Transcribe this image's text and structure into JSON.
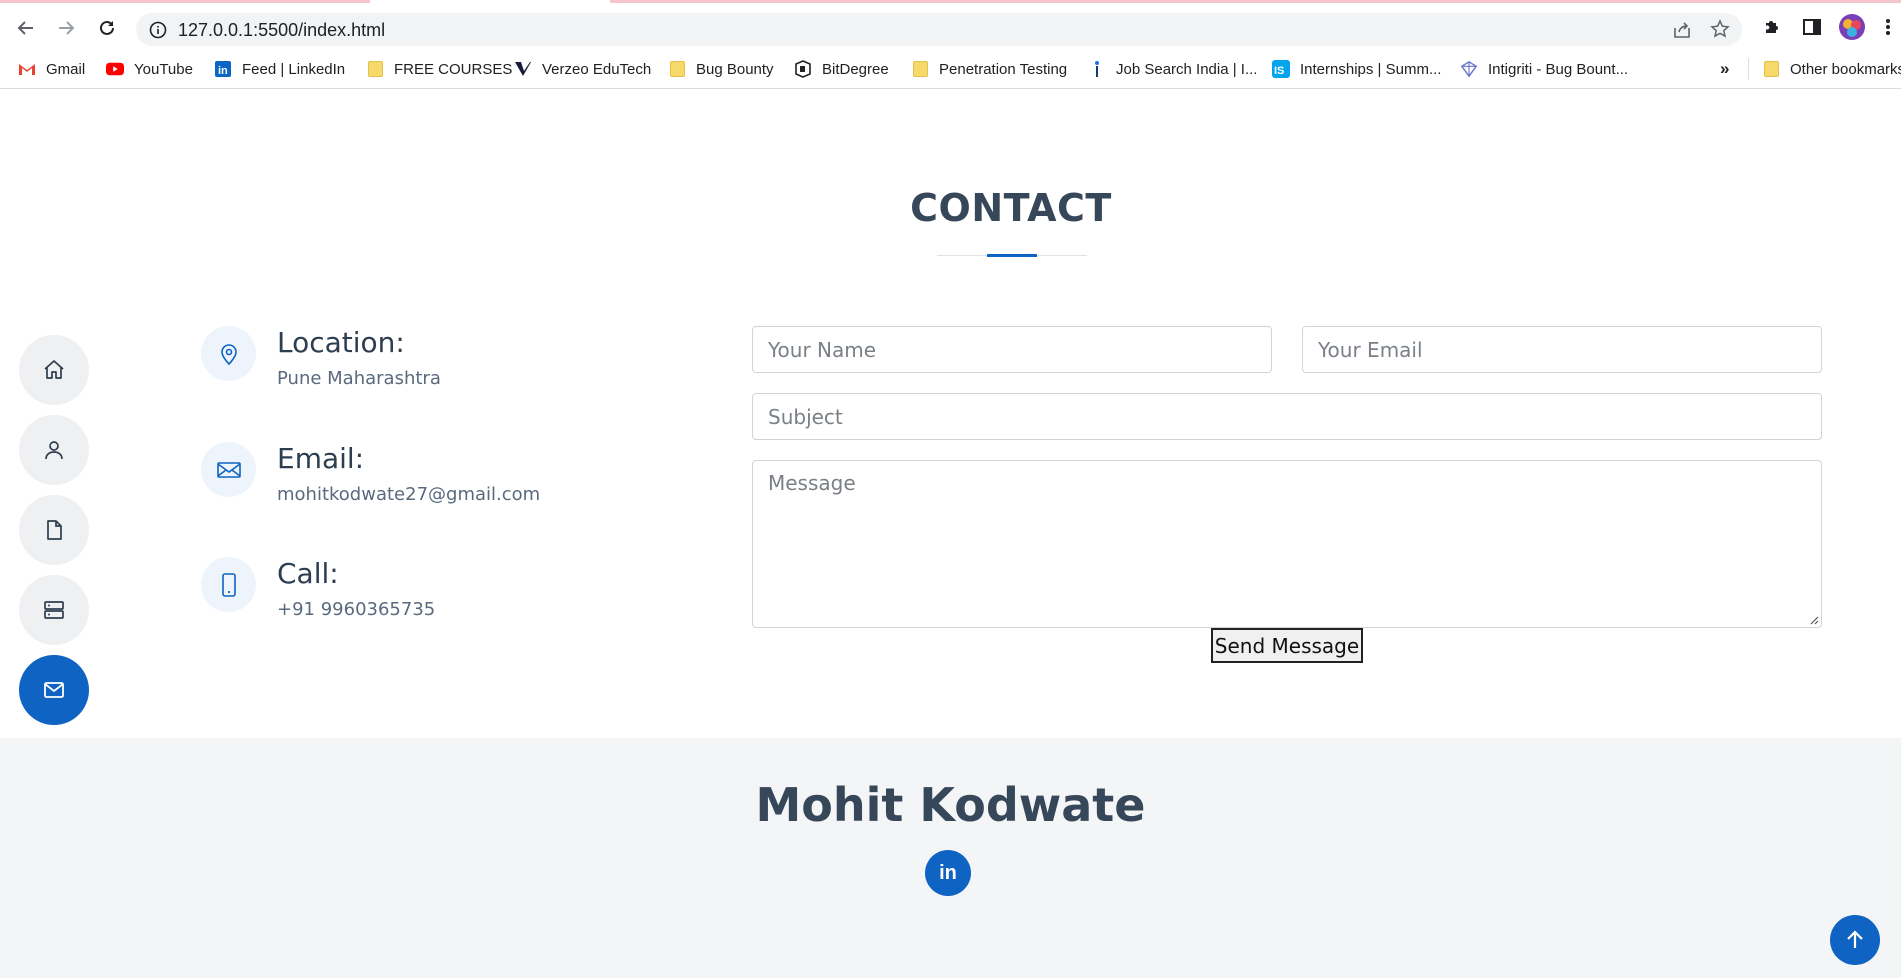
{
  "browser": {
    "url": "127.0.0.1:5500/index.html",
    "bookmarks": [
      {
        "label": "Gmail"
      },
      {
        "label": "YouTube"
      },
      {
        "label": "Feed | LinkedIn"
      },
      {
        "label": "FREE COURSES"
      },
      {
        "label": "Verzeo EduTech"
      },
      {
        "label": "Bug Bounty"
      },
      {
        "label": "BitDegree"
      },
      {
        "label": "Penetration Testing"
      },
      {
        "label": "Job Search India | I..."
      },
      {
        "label": "Internships | Summ..."
      },
      {
        "label": "Intigriti - Bug Bount..."
      }
    ],
    "overflow_label": "»",
    "other_bookmarks": "Other bookmarks"
  },
  "section": {
    "title": "CONTACT"
  },
  "contact_info": [
    {
      "label": "Location:",
      "value": "Pune Maharashtra",
      "icon": "map-pin-icon"
    },
    {
      "label": "Email:",
      "value": "mohitkodwate27@gmail.com",
      "icon": "envelope-icon"
    },
    {
      "label": "Call:",
      "value": "+91 9960365735",
      "icon": "phone-icon"
    }
  ],
  "form": {
    "name_placeholder": "Your Name",
    "email_placeholder": "Your Email",
    "subject_placeholder": "Subject",
    "message_placeholder": "Message",
    "submit_label": "Send Message"
  },
  "footer": {
    "name": "Mohit Kodwate",
    "social": "in"
  },
  "colors": {
    "accent": "#0f63c2",
    "heading": "#37475a",
    "footer_bg": "#f3f5f7"
  }
}
